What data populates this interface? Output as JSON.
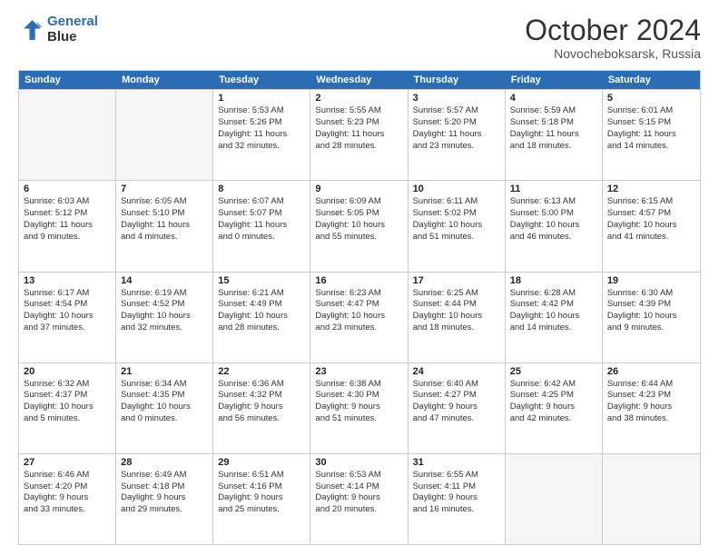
{
  "logo": {
    "line1": "General",
    "line2": "Blue"
  },
  "title": "October 2024",
  "location": "Novocheboksarsk, Russia",
  "header_days": [
    "Sunday",
    "Monday",
    "Tuesday",
    "Wednesday",
    "Thursday",
    "Friday",
    "Saturday"
  ],
  "rows": [
    [
      {
        "day": "",
        "sunrise": "",
        "sunset": "",
        "daylight": "",
        "empty": true
      },
      {
        "day": "",
        "sunrise": "",
        "sunset": "",
        "daylight": "",
        "empty": true
      },
      {
        "day": "1",
        "sunrise": "Sunrise: 5:53 AM",
        "sunset": "Sunset: 5:26 PM",
        "daylight": "Daylight: 11 hours",
        "daylight2": "and 32 minutes."
      },
      {
        "day": "2",
        "sunrise": "Sunrise: 5:55 AM",
        "sunset": "Sunset: 5:23 PM",
        "daylight": "Daylight: 11 hours",
        "daylight2": "and 28 minutes."
      },
      {
        "day": "3",
        "sunrise": "Sunrise: 5:57 AM",
        "sunset": "Sunset: 5:20 PM",
        "daylight": "Daylight: 11 hours",
        "daylight2": "and 23 minutes."
      },
      {
        "day": "4",
        "sunrise": "Sunrise: 5:59 AM",
        "sunset": "Sunset: 5:18 PM",
        "daylight": "Daylight: 11 hours",
        "daylight2": "and 18 minutes."
      },
      {
        "day": "5",
        "sunrise": "Sunrise: 6:01 AM",
        "sunset": "Sunset: 5:15 PM",
        "daylight": "Daylight: 11 hours",
        "daylight2": "and 14 minutes."
      }
    ],
    [
      {
        "day": "6",
        "sunrise": "Sunrise: 6:03 AM",
        "sunset": "Sunset: 5:12 PM",
        "daylight": "Daylight: 11 hours",
        "daylight2": "and 9 minutes."
      },
      {
        "day": "7",
        "sunrise": "Sunrise: 6:05 AM",
        "sunset": "Sunset: 5:10 PM",
        "daylight": "Daylight: 11 hours",
        "daylight2": "and 4 minutes."
      },
      {
        "day": "8",
        "sunrise": "Sunrise: 6:07 AM",
        "sunset": "Sunset: 5:07 PM",
        "daylight": "Daylight: 11 hours",
        "daylight2": "and 0 minutes."
      },
      {
        "day": "9",
        "sunrise": "Sunrise: 6:09 AM",
        "sunset": "Sunset: 5:05 PM",
        "daylight": "Daylight: 10 hours",
        "daylight2": "and 55 minutes."
      },
      {
        "day": "10",
        "sunrise": "Sunrise: 6:11 AM",
        "sunset": "Sunset: 5:02 PM",
        "daylight": "Daylight: 10 hours",
        "daylight2": "and 51 minutes."
      },
      {
        "day": "11",
        "sunrise": "Sunrise: 6:13 AM",
        "sunset": "Sunset: 5:00 PM",
        "daylight": "Daylight: 10 hours",
        "daylight2": "and 46 minutes."
      },
      {
        "day": "12",
        "sunrise": "Sunrise: 6:15 AM",
        "sunset": "Sunset: 4:57 PM",
        "daylight": "Daylight: 10 hours",
        "daylight2": "and 41 minutes."
      }
    ],
    [
      {
        "day": "13",
        "sunrise": "Sunrise: 6:17 AM",
        "sunset": "Sunset: 4:54 PM",
        "daylight": "Daylight: 10 hours",
        "daylight2": "and 37 minutes."
      },
      {
        "day": "14",
        "sunrise": "Sunrise: 6:19 AM",
        "sunset": "Sunset: 4:52 PM",
        "daylight": "Daylight: 10 hours",
        "daylight2": "and 32 minutes."
      },
      {
        "day": "15",
        "sunrise": "Sunrise: 6:21 AM",
        "sunset": "Sunset: 4:49 PM",
        "daylight": "Daylight: 10 hours",
        "daylight2": "and 28 minutes."
      },
      {
        "day": "16",
        "sunrise": "Sunrise: 6:23 AM",
        "sunset": "Sunset: 4:47 PM",
        "daylight": "Daylight: 10 hours",
        "daylight2": "and 23 minutes."
      },
      {
        "day": "17",
        "sunrise": "Sunrise: 6:25 AM",
        "sunset": "Sunset: 4:44 PM",
        "daylight": "Daylight: 10 hours",
        "daylight2": "and 18 minutes."
      },
      {
        "day": "18",
        "sunrise": "Sunrise: 6:28 AM",
        "sunset": "Sunset: 4:42 PM",
        "daylight": "Daylight: 10 hours",
        "daylight2": "and 14 minutes."
      },
      {
        "day": "19",
        "sunrise": "Sunrise: 6:30 AM",
        "sunset": "Sunset: 4:39 PM",
        "daylight": "Daylight: 10 hours",
        "daylight2": "and 9 minutes."
      }
    ],
    [
      {
        "day": "20",
        "sunrise": "Sunrise: 6:32 AM",
        "sunset": "Sunset: 4:37 PM",
        "daylight": "Daylight: 10 hours",
        "daylight2": "and 5 minutes."
      },
      {
        "day": "21",
        "sunrise": "Sunrise: 6:34 AM",
        "sunset": "Sunset: 4:35 PM",
        "daylight": "Daylight: 10 hours",
        "daylight2": "and 0 minutes."
      },
      {
        "day": "22",
        "sunrise": "Sunrise: 6:36 AM",
        "sunset": "Sunset: 4:32 PM",
        "daylight": "Daylight: 9 hours",
        "daylight2": "and 56 minutes."
      },
      {
        "day": "23",
        "sunrise": "Sunrise: 6:38 AM",
        "sunset": "Sunset: 4:30 PM",
        "daylight": "Daylight: 9 hours",
        "daylight2": "and 51 minutes."
      },
      {
        "day": "24",
        "sunrise": "Sunrise: 6:40 AM",
        "sunset": "Sunset: 4:27 PM",
        "daylight": "Daylight: 9 hours",
        "daylight2": "and 47 minutes."
      },
      {
        "day": "25",
        "sunrise": "Sunrise: 6:42 AM",
        "sunset": "Sunset: 4:25 PM",
        "daylight": "Daylight: 9 hours",
        "daylight2": "and 42 minutes."
      },
      {
        "day": "26",
        "sunrise": "Sunrise: 6:44 AM",
        "sunset": "Sunset: 4:23 PM",
        "daylight": "Daylight: 9 hours",
        "daylight2": "and 38 minutes."
      }
    ],
    [
      {
        "day": "27",
        "sunrise": "Sunrise: 6:46 AM",
        "sunset": "Sunset: 4:20 PM",
        "daylight": "Daylight: 9 hours",
        "daylight2": "and 33 minutes."
      },
      {
        "day": "28",
        "sunrise": "Sunrise: 6:49 AM",
        "sunset": "Sunset: 4:18 PM",
        "daylight": "Daylight: 9 hours",
        "daylight2": "and 29 minutes."
      },
      {
        "day": "29",
        "sunrise": "Sunrise: 6:51 AM",
        "sunset": "Sunset: 4:16 PM",
        "daylight": "Daylight: 9 hours",
        "daylight2": "and 25 minutes."
      },
      {
        "day": "30",
        "sunrise": "Sunrise: 6:53 AM",
        "sunset": "Sunset: 4:14 PM",
        "daylight": "Daylight: 9 hours",
        "daylight2": "and 20 minutes."
      },
      {
        "day": "31",
        "sunrise": "Sunrise: 6:55 AM",
        "sunset": "Sunset: 4:11 PM",
        "daylight": "Daylight: 9 hours",
        "daylight2": "and 16 minutes."
      },
      {
        "day": "",
        "sunrise": "",
        "sunset": "",
        "daylight": "",
        "daylight2": "",
        "empty": true
      },
      {
        "day": "",
        "sunrise": "",
        "sunset": "",
        "daylight": "",
        "daylight2": "",
        "empty": true
      }
    ]
  ]
}
